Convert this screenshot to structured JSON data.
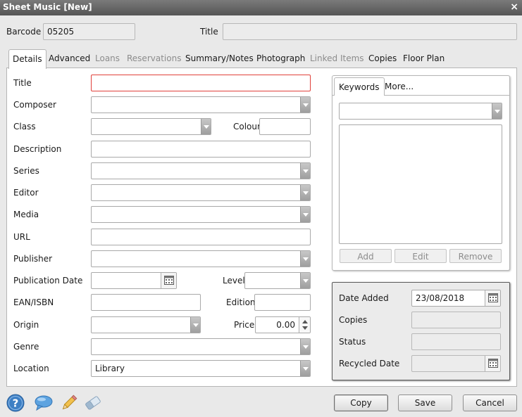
{
  "window": {
    "title": "Sheet Music [New]",
    "close": "×"
  },
  "header": {
    "barcode_label": "Barcode",
    "barcode_value": "05205",
    "title_label": "Title",
    "title_value": ""
  },
  "tabs": [
    {
      "label": "Details"
    },
    {
      "label": "Advanced"
    },
    {
      "label": "Loans"
    },
    {
      "label": "Reservations"
    },
    {
      "label": "Summary/Notes"
    },
    {
      "label": "Photograph"
    },
    {
      "label": "Linked Items"
    },
    {
      "label": "Copies"
    },
    {
      "label": "Floor Plan"
    }
  ],
  "form": {
    "title": "Title",
    "composer": "Composer",
    "class": "Class",
    "colour": "Colour",
    "description": "Description",
    "series": "Series",
    "editor": "Editor",
    "media": "Media",
    "url": "URL",
    "publisher": "Publisher",
    "publication_date": "Publication Date",
    "level": "Level",
    "ean_isbn": "EAN/ISBN",
    "edition": "Edition",
    "origin": "Origin",
    "price": "Price",
    "price_value": "0.00",
    "genre": "Genre",
    "location": "Location",
    "location_value": "Library"
  },
  "keywords": {
    "tabs": [
      {
        "label": "Keywords"
      },
      {
        "label": "More..."
      }
    ],
    "add": "Add",
    "edit": "Edit",
    "remove": "Remove"
  },
  "info": {
    "date_added_label": "Date Added",
    "date_added_value": "23/08/2018",
    "copies_label": "Copies",
    "status_label": "Status",
    "recycled_label": "Recycled Date"
  },
  "buttons": {
    "copy": "Copy",
    "save": "Save",
    "cancel": "Cancel"
  },
  "colors": {
    "title_bar": "#5f5f5f",
    "error_border": "#e0403a",
    "help_blue": "#3d7fc4"
  }
}
